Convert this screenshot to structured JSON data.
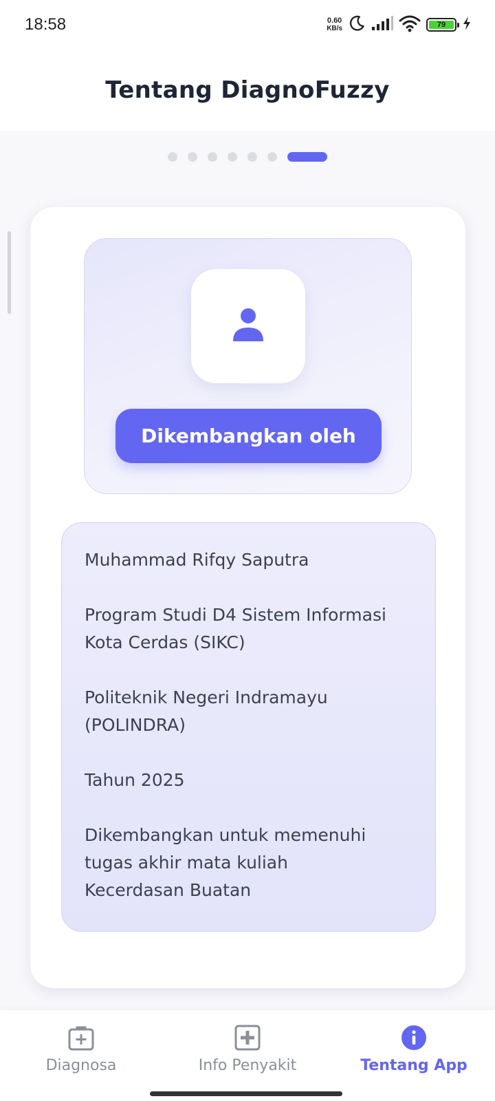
{
  "status_bar": {
    "time": "18:58",
    "net_speed_value": "0.60",
    "net_speed_unit": "KB/s",
    "battery_level": "79",
    "icons": [
      "moon-icon",
      "signal-icon",
      "wifi-icon",
      "battery-icon",
      "charging-icon"
    ]
  },
  "app_bar": {
    "title": "Tentang DiagnoFuzzy"
  },
  "pager": {
    "total": 7,
    "active_index": 6
  },
  "developer_card": {
    "avatar_icon": "person-icon",
    "heading": "Dikembangkan oleh",
    "paragraphs": [
      "Muhammad Rifqy Saputra",
      "Program Studi D4 Sistem Informasi\nKota Cerdas (SIKC)",
      "Politeknik Negeri Indramayu\n(POLINDRA)",
      "Tahun 2025",
      "Dikembangkan untuk memenuhi\ntugas akhir mata kuliah\nKecerdasan Buatan"
    ]
  },
  "bottom_nav": {
    "items": [
      {
        "label": "Diagnosa",
        "icon": "medical-kit-icon",
        "active": false
      },
      {
        "label": "Info Penyakit",
        "icon": "medical-cross-icon",
        "active": false
      },
      {
        "label": "Tentang App",
        "icon": "info-icon",
        "active": true
      }
    ]
  },
  "colors": {
    "accent": "#6366f1",
    "inactive_nav": "#8a8f99",
    "title_text": "#1e2535"
  }
}
